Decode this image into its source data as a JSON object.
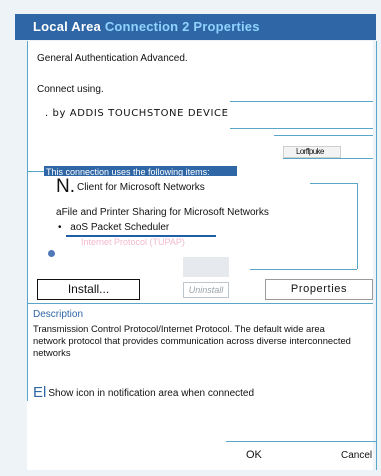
{
  "window": {
    "title_prefix": "Local Area ",
    "title_accent": "Connection 2 Properties",
    "accent_color": "#8fd3ff",
    "title_bar_color": "#2f66a6"
  },
  "tabs": {
    "text": "General Authentication Advanced."
  },
  "connect": {
    "label": "Connect using.",
    "adapter": ". by ADDIS TOUCHSTONE DEVICE",
    "configure_label": "Lorffpuke"
  },
  "items": {
    "heading": "This connection uses the following items:",
    "list": [
      {
        "prefix": "N.",
        "label": "Client for Microsoft Networks"
      },
      {
        "prefix": "a",
        "label": "File and Printer Sharing for Microsoft Networks"
      },
      {
        "prefix": "•",
        "label": "aoS Packet Scheduler"
      },
      {
        "prefix": "",
        "label": "Internet Protocol (TUPAP)"
      }
    ]
  },
  "buttons": {
    "install": "Install...",
    "uninstall": "Uninstall",
    "properties": "Properties",
    "ok": "OK",
    "cancel": "Cancel"
  },
  "description": {
    "label": "Description",
    "text": "Transmission Control Protocol/Internet Protocol. The default wide area network protocol that provides communication across diverse interconnected networks"
  },
  "notification": {
    "prefix": "El",
    "label": "Show icon in notification area when connected"
  }
}
